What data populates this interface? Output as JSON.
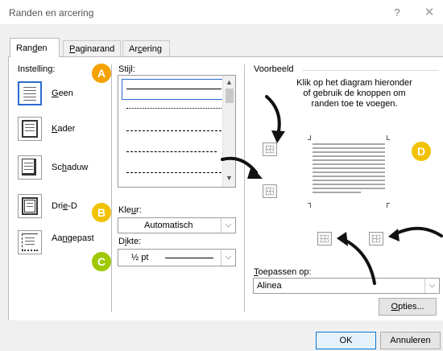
{
  "window": {
    "title": "Randen en arcering",
    "help_symbol": "?",
    "close_symbol": "✕"
  },
  "tabs": [
    {
      "pre": "Ran",
      "key": "d",
      "post": "en"
    },
    {
      "pre": "",
      "key": "P",
      "post": "aginarand"
    },
    {
      "pre": "Ar",
      "key": "c",
      "post": "ering"
    }
  ],
  "setting": {
    "label": "Instelling:",
    "items": [
      {
        "pre": "",
        "key": "G",
        "post": "een"
      },
      {
        "pre": "",
        "key": "K",
        "post": "ader"
      },
      {
        "pre": "Sc",
        "key": "h",
        "post": "aduw"
      },
      {
        "pre": "Dri",
        "key": "e",
        "post": "-D"
      },
      {
        "pre": "Aa",
        "key": "n",
        "post": "gepast"
      }
    ]
  },
  "style": {
    "label_pre": "Sti",
    "label_key": "j",
    "label_post": "l:"
  },
  "color": {
    "label_pre": "Kle",
    "label_key": "u",
    "label_post": "r:",
    "value": "Automatisch"
  },
  "width": {
    "label_pre": "D",
    "label_key": "i",
    "label_post": "kte:",
    "value": "½ pt"
  },
  "preview": {
    "label": "Voorbeeld",
    "instruction": [
      "Klik op het diagram hieronder",
      "of gebruik de knoppen om",
      "randen toe te voegen."
    ]
  },
  "apply": {
    "label_pre": "",
    "label_key": "T",
    "label_post": "oepassen op:",
    "value": "Alinea"
  },
  "options_button": {
    "pre": "",
    "key": "O",
    "post": "pties..."
  },
  "footer": {
    "ok": "OK",
    "cancel": "Annuleren"
  },
  "badges": {
    "a": "A",
    "b": "B",
    "c": "C",
    "d": "D"
  },
  "dropdown_arrow": "⌵",
  "scroll_up": "▲",
  "scroll_down": "▼",
  "colors": {
    "accent": "#2a6ccf",
    "badge_a": "#f5a200",
    "badge_b": "#f1c200",
    "badge_c": "#a0c800",
    "badge_d": "#f1c200"
  }
}
